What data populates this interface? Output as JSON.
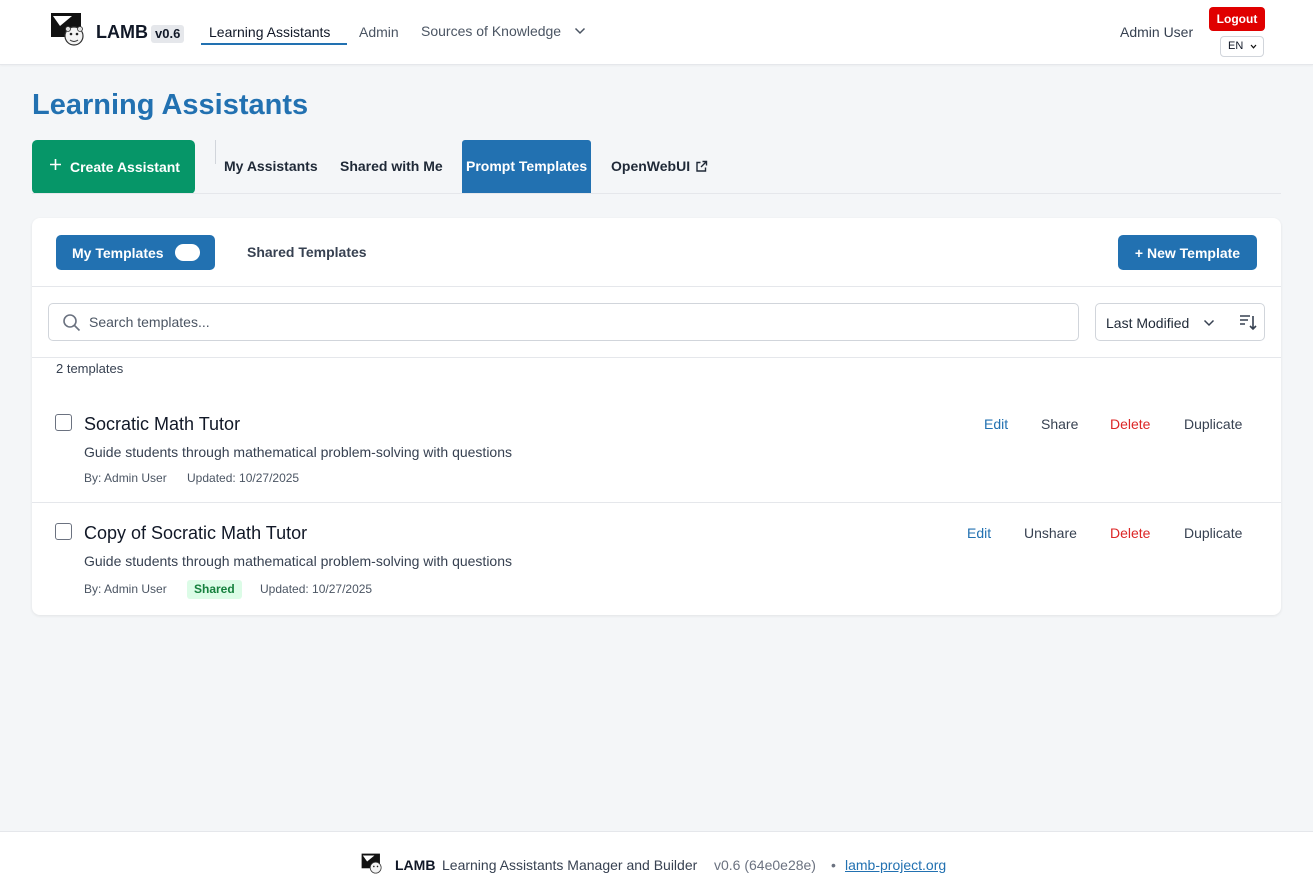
{
  "header": {
    "brand": "LAMB",
    "version": "v0.6",
    "nav": {
      "learning_assistants": "Learning Assistants",
      "admin": "Admin",
      "sources": "Sources of Knowledge"
    },
    "user_name": "Admin User",
    "logout_label": "Logout",
    "language": "EN"
  },
  "page": {
    "title": "Learning Assistants",
    "create_label": "Create Assistant",
    "tabs": {
      "my_assistants": "My Assistants",
      "shared_with_me": "Shared with Me",
      "prompt_templates": "Prompt Templates",
      "openwebui": "OpenWebUI"
    },
    "active_tab": "Prompt Templates"
  },
  "templates_panel": {
    "my_templates_label": "My Templates",
    "shared_templates_label": "Shared Templates",
    "new_template_label": "+ New Template",
    "search_placeholder": "Search templates...",
    "sort_label": "Last Modified",
    "count_label": "2 templates",
    "actions": {
      "edit": "Edit",
      "delete": "Delete",
      "duplicate": "Duplicate"
    },
    "items": [
      {
        "title": "Socratic Math Tutor",
        "description": "Guide students through mathematical problem-solving with questions",
        "author": "By: Admin User",
        "updated": "Updated: 10/27/2025",
        "share_action": "Share"
      },
      {
        "title": "Copy of Socratic Math Tutor",
        "description": "Guide students through mathematical problem-solving with questions",
        "author": "By: Admin User",
        "shared_badge": "Shared",
        "updated": "Updated: 10/27/2025",
        "share_action": "Unshare"
      }
    ]
  },
  "footer": {
    "brand": "LAMB",
    "description": "Learning Assistants Manager and Builder",
    "version": "v0.6 (64e0e28e)",
    "separator": "•",
    "link": "lamb-project.org"
  },
  "colors": {
    "primary_blue": "#2271b1",
    "create_green": "#069668",
    "logout_red": "#e00000",
    "delete_red": "#dc2626",
    "shared_badge_bg": "#dcfce7"
  },
  "icons": {
    "logo": "lamb-logo-icon",
    "dropdown": "chevron-down-icon",
    "create": "plus-icon",
    "external": "external-link-icon",
    "search": "search-icon",
    "sort_direction": "sort-descending-icon"
  }
}
